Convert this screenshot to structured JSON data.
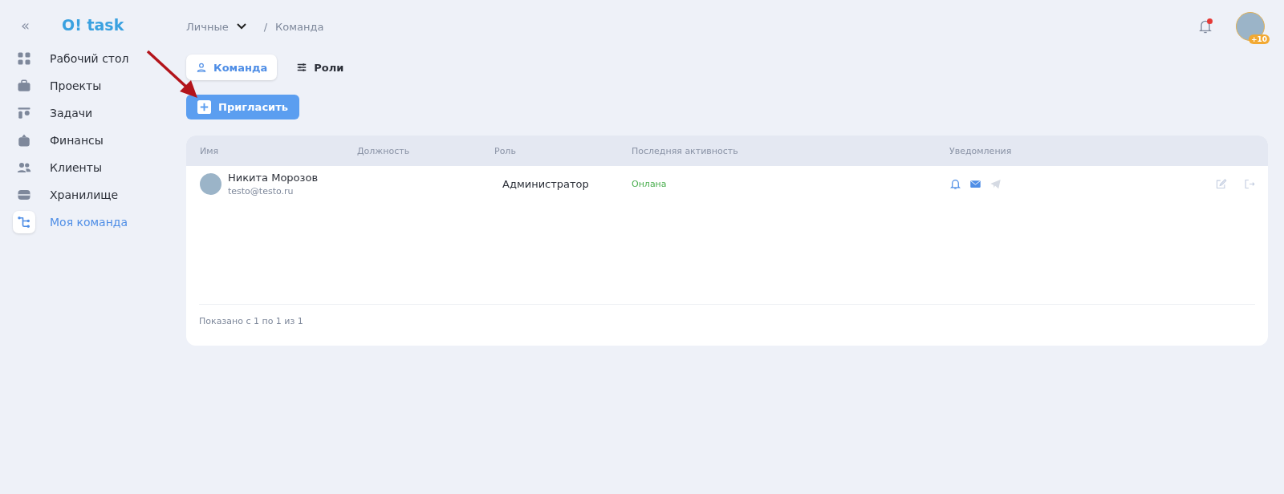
{
  "collapse": "«",
  "logo": "O! task",
  "sidebar": {
    "items": [
      {
        "kind": "dashboard",
        "label": "Рабочий стол",
        "selected": false
      },
      {
        "kind": "projects",
        "label": "Проекты",
        "selected": false
      },
      {
        "kind": "tasks",
        "label": "Задачи",
        "selected": false
      },
      {
        "kind": "finance",
        "label": "Финансы",
        "selected": false
      },
      {
        "kind": "clients",
        "label": "Клиенты",
        "selected": false
      },
      {
        "kind": "storage",
        "label": "Хранилище",
        "selected": false
      },
      {
        "kind": "team",
        "label": "Моя команда",
        "selected": true
      }
    ]
  },
  "breadcrumb": {
    "workspace": "Личные",
    "separator": "/",
    "page": "Команда"
  },
  "header": {
    "unread_notifications": true,
    "avatar_badge": "+10"
  },
  "tabs": [
    {
      "kind": "team",
      "label": "Команда",
      "selected": true
    },
    {
      "kind": "roles",
      "label": "Роли",
      "selected": false
    }
  ],
  "invite_button": "Пригласить",
  "table": {
    "columns": [
      "Имя",
      "Должность",
      "Роль",
      "Последняя активность",
      "Уведомления"
    ],
    "rows": [
      {
        "name": "Никита Морозов",
        "email": "testo@testo.ru",
        "role": "Администратор",
        "activity": "Онлана",
        "notifications": [
          {
            "kind": "bell",
            "on": true
          },
          {
            "kind": "mail",
            "on": true
          },
          {
            "kind": "telegram",
            "on": false
          }
        ]
      }
    ],
    "footer": "Показано с 1 по 1 из 1"
  }
}
